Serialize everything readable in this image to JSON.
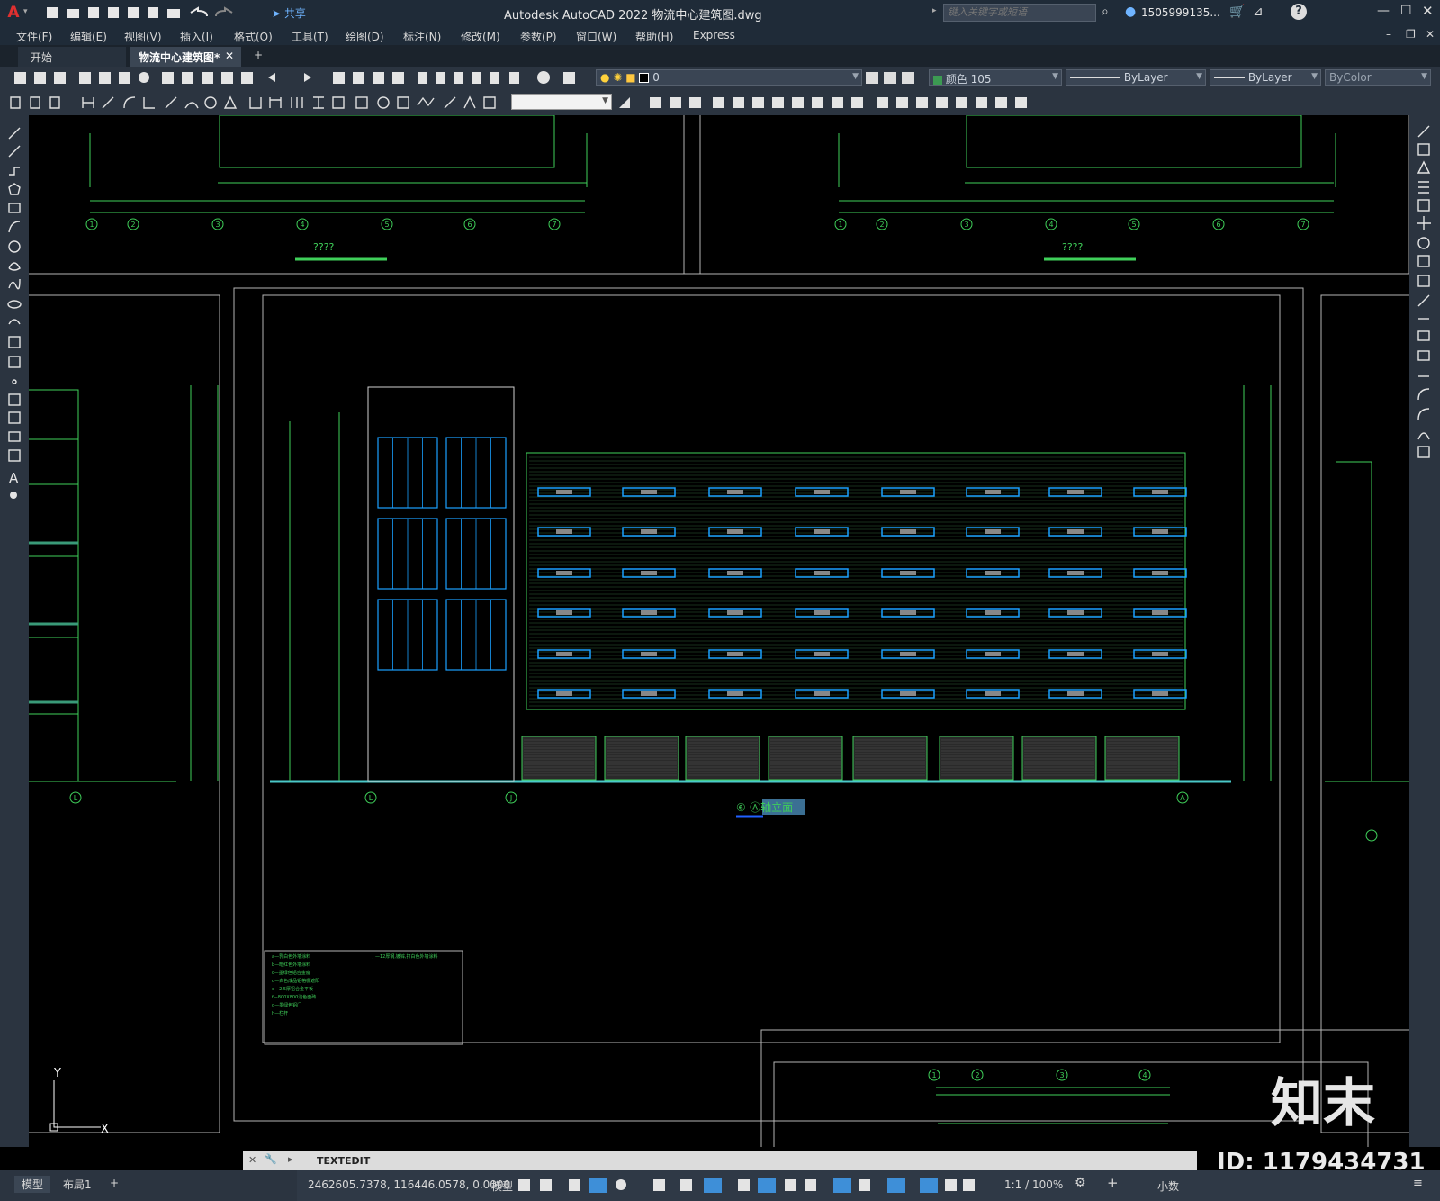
{
  "titlebar": {
    "app_logo": "A",
    "share_label": "共享",
    "title": "Autodesk AutoCAD 2022    物流中心建筑图.dwg",
    "search_placeholder": "键入关键字或短语",
    "user": "1505999135...",
    "help": "?"
  },
  "menu": [
    "文件(F)",
    "编辑(E)",
    "视图(V)",
    "插入(I)",
    "格式(O)",
    "工具(T)",
    "绘图(D)",
    "标注(N)",
    "修改(M)",
    "参数(P)",
    "窗口(W)",
    "帮助(H)",
    "Express"
  ],
  "tabs": {
    "start": "开始",
    "active": "物流中心建筑图*",
    "add": "+"
  },
  "layer_combo": "0",
  "color_combo": "颜色 105",
  "linetype_combo": "ByLayer",
  "lineweight_combo": "ByLayer",
  "plotstyle_combo": "ByColor",
  "drawing": {
    "title_top_left": "????",
    "title_top_right": "????",
    "elevation_title": "⑥-Ⓐ轴立面",
    "grid_top": [
      "1",
      "2",
      "3",
      "4",
      "5",
      "6",
      "7"
    ],
    "grid_bottom": [
      "1",
      "2",
      "3",
      "4"
    ],
    "axis_left": "L",
    "axis_mid1": "L",
    "axis_mid2": "J",
    "axis_right": "A",
    "ucs_x": "X",
    "ucs_y": "Y",
    "legend_lines": [
      "a—乳白色外墙涂料",
      "b—暗红色外墙涂料",
      "c—墨绿色铝合金窗",
      "d—白色成品铝格栅遮阳",
      "e—2.5厚铝合金平板",
      "f—800X800浅色面砖",
      "g—墨绿色铝门",
      "h—栏杆"
    ],
    "legend_right": "j —12厚钢,镀锌,打白色外墙涂料"
  },
  "watermark": {
    "brand": "知末",
    "id": "ID: 1179434731"
  },
  "command": {
    "label": "TEXTEDIT"
  },
  "layout_tabs": [
    "模型",
    "布局1",
    "+"
  ],
  "status": {
    "coords": "2462605.7378, 116446.0578, 0.0000",
    "model": "模型",
    "scale": "1:1 / 100%",
    "units": "小数"
  }
}
